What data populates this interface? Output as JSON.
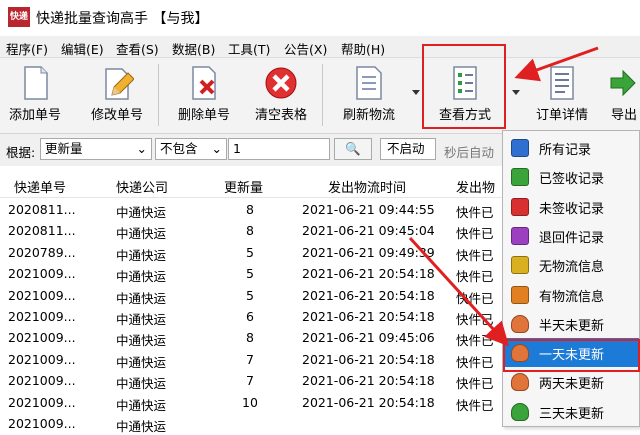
{
  "window": {
    "title": "快递批量查询高手 【与我】",
    "icon_text": "快递"
  },
  "menu": [
    "程序(F)",
    "编辑(E)",
    "查看(S)",
    "数据(B)",
    "工具(T)",
    "公告(X)",
    "帮助(H)"
  ],
  "toolbar": [
    {
      "label": "添加单号",
      "icon": "add-doc-icon"
    },
    {
      "label": "修改单号",
      "icon": "edit-pencil-icon"
    },
    {
      "label": "删除单号",
      "icon": "delete-doc-icon"
    },
    {
      "label": "清空表格",
      "icon": "clear-red-x-icon"
    },
    {
      "label": "刷新物流",
      "icon": "refresh-list-icon"
    },
    {
      "label": "查看方式",
      "icon": "view-checklist-icon"
    },
    {
      "label": "订单详情",
      "icon": "order-detail-icon"
    },
    {
      "label": "导出",
      "icon": "export-arrow-icon"
    }
  ],
  "filter": {
    "prefix": "根据:",
    "field": "更新量",
    "condition": "不包含",
    "value": "1",
    "auto_button": "不启动",
    "auto_hint": "秒后自动"
  },
  "table": {
    "headers": [
      "快递单号",
      "快递公司",
      "更新量",
      "发出物流时间",
      "发出物"
    ],
    "rows": [
      [
        "2020811...",
        "中通快运",
        "8",
        "2021-06-21 09:44:55",
        "快件已"
      ],
      [
        "2020811...",
        "中通快运",
        "8",
        "2021-06-21 09:45:04",
        "快件已"
      ],
      [
        "2020789...",
        "中通快运",
        "5",
        "2021-06-21 09:49:39",
        "快件已"
      ],
      [
        "2021009...",
        "中通快运",
        "5",
        "2021-06-21 20:54:18",
        "快件已"
      ],
      [
        "2021009...",
        "中通快运",
        "5",
        "2021-06-21 20:54:18",
        "快件已"
      ],
      [
        "2021009...",
        "中通快运",
        "6",
        "2021-06-21 20:54:18",
        "快件已"
      ],
      [
        "2021009...",
        "中通快运",
        "8",
        "2021-06-21 09:45:06",
        "快件已"
      ],
      [
        "2021009...",
        "中通快运",
        "7",
        "2021-06-21 20:54:18",
        "快件已"
      ],
      [
        "2021009...",
        "中通快运",
        "7",
        "2021-06-21 20:54:18",
        "快件已"
      ],
      [
        "2021009...",
        "中通快运",
        "10",
        "2021-06-21 20:54:18",
        "快件已"
      ],
      [
        "2021009...",
        "中通快运",
        "",
        "",
        ""
      ]
    ]
  },
  "dropdown": [
    {
      "label": "所有记录",
      "icon": "megaphone-icon",
      "color": "#2f6fd0"
    },
    {
      "label": "已签收记录",
      "icon": "green-check-hand-icon",
      "color": "#3aa33a"
    },
    {
      "label": "未签收记录",
      "icon": "red-hand-icon",
      "color": "#d83030"
    },
    {
      "label": "退回件记录",
      "icon": "purple-hand-icon",
      "color": "#9a40c0"
    },
    {
      "label": "无物流信息",
      "icon": "yellow-hand-icon",
      "color": "#d9b020"
    },
    {
      "label": "有物流信息",
      "icon": "orange-hand-icon",
      "color": "#e08020"
    },
    {
      "label": "半天未更新",
      "icon": "orange-bag-icon",
      "color": "#e0743a"
    },
    {
      "label": "一天未更新",
      "icon": "orange-bag-icon",
      "color": "#e0743a",
      "selected": true
    },
    {
      "label": "两天未更新",
      "icon": "orange-bag-icon",
      "color": "#e0743a"
    },
    {
      "label": "三天未更新",
      "icon": "green-bag-icon",
      "color": "#3aa33a"
    }
  ],
  "colors": {
    "highlight": "#e02020",
    "selection": "#1d7bd8"
  }
}
